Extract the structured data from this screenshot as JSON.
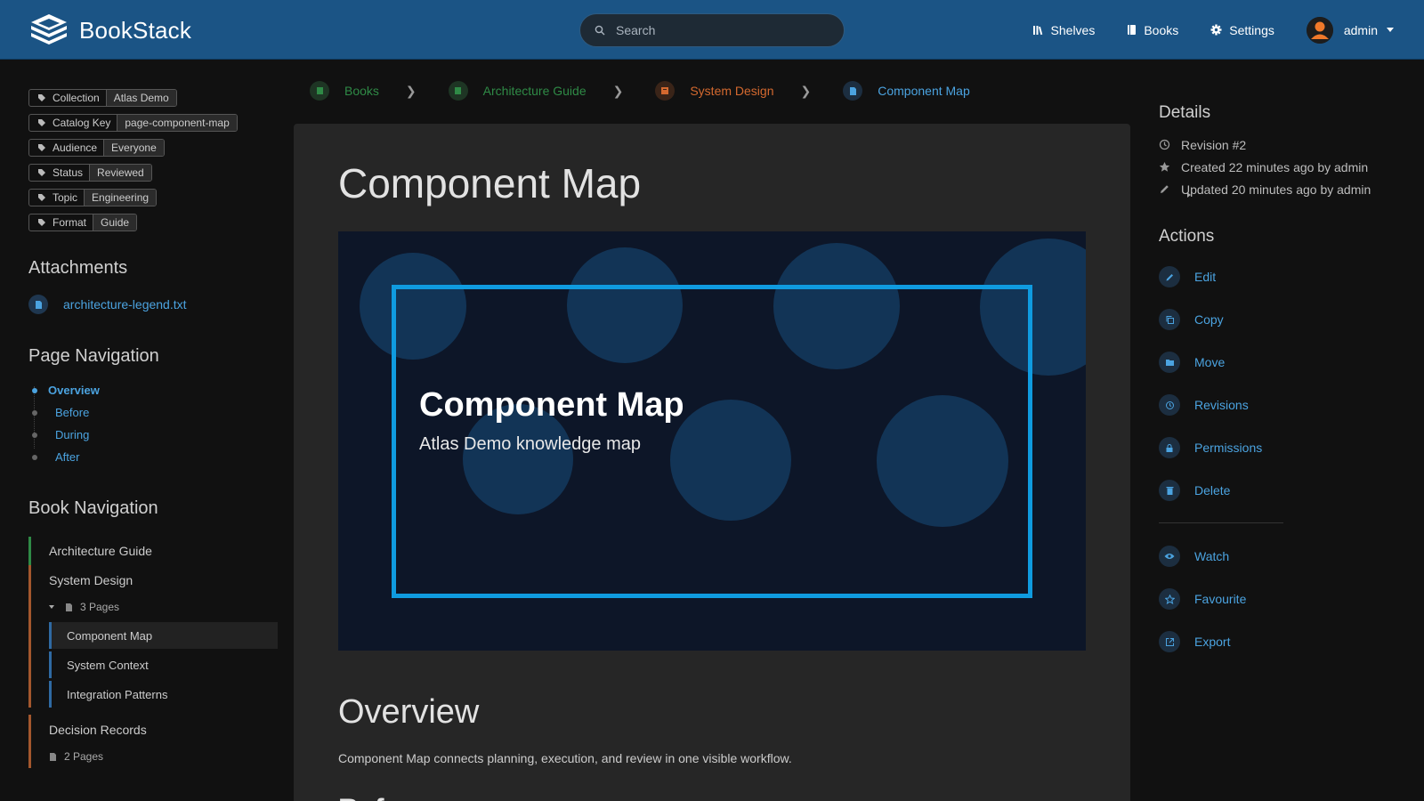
{
  "header": {
    "app_name": "BookStack",
    "search_placeholder": "Search",
    "nav": [
      {
        "label": "Shelves",
        "icon": "shelves-icon"
      },
      {
        "label": "Books",
        "icon": "book-icon"
      },
      {
        "label": "Settings",
        "icon": "gear-icon"
      }
    ],
    "user": {
      "name": "admin"
    }
  },
  "tags": [
    {
      "name": "Collection",
      "value": "Atlas Demo"
    },
    {
      "name": "Catalog Key",
      "value": "page-component-map"
    },
    {
      "name": "Audience",
      "value": "Everyone"
    },
    {
      "name": "Status",
      "value": "Reviewed"
    },
    {
      "name": "Topic",
      "value": "Engineering"
    },
    {
      "name": "Format",
      "value": "Guide"
    }
  ],
  "attachments": {
    "heading": "Attachments",
    "items": [
      {
        "name": "architecture-legend.txt"
      }
    ]
  },
  "page_navigation": {
    "heading": "Page Navigation",
    "items": [
      {
        "label": "Overview",
        "active": true
      },
      {
        "label": "Before"
      },
      {
        "label": "During"
      },
      {
        "label": "After"
      }
    ]
  },
  "book_navigation": {
    "heading": "Book Navigation",
    "book": "Architecture Guide",
    "chapters": [
      {
        "title": "System Design",
        "count": "3 Pages",
        "expanded": true,
        "pages": [
          "Component Map",
          "System Context",
          "Integration Patterns"
        ]
      },
      {
        "title": "Decision Records",
        "count": "2 Pages",
        "expanded": false
      }
    ]
  },
  "breadcrumbs": [
    {
      "label": "Books",
      "color": "#2f8a46"
    },
    {
      "label": "Architecture Guide",
      "color": "#2f8a46"
    },
    {
      "label": "System Design",
      "color": "#d4692f"
    },
    {
      "label": "Component Map",
      "color": "#4ba3e0"
    }
  ],
  "page": {
    "title": "Component Map",
    "hero": {
      "title": "Component Map",
      "subtitle": "Atlas Demo knowledge map"
    },
    "section_heading": "Overview",
    "paragraph": "Component Map connects planning, execution, and review in one visible workflow.",
    "next_heading": "Bef"
  },
  "details": {
    "heading": "Details",
    "revision": "Revision #2",
    "created": "Created 22 minutes ago by admin",
    "updated": "Updated 20 minutes ago by admin"
  },
  "actions": {
    "heading": "Actions",
    "primary": [
      "Edit",
      "Copy",
      "Move",
      "Revisions",
      "Permissions",
      "Delete"
    ],
    "secondary": [
      "Watch",
      "Favourite",
      "Export"
    ]
  },
  "colors": {
    "header": "#1b5485",
    "link": "#4ba3e0",
    "book": "#2f8a46",
    "chapter": "#a3572d",
    "page": "#2f6aa3",
    "hero_frame": "#0f9be0"
  }
}
